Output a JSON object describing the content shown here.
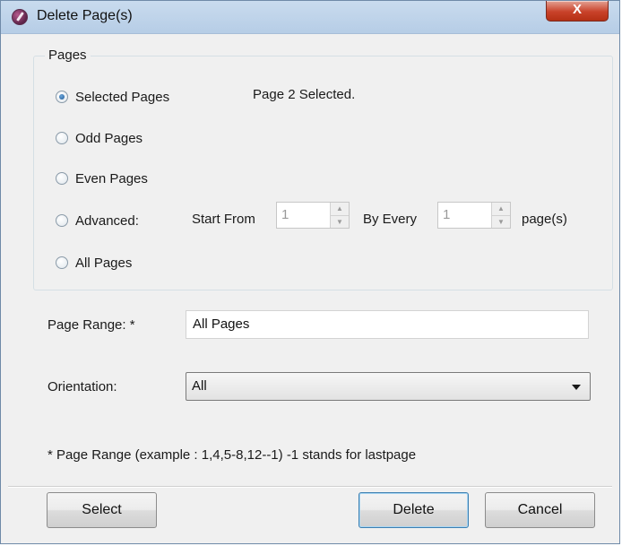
{
  "window": {
    "title": "Delete Page(s)",
    "close_symbol": "X"
  },
  "pages_group": {
    "legend": "Pages",
    "selected_info": "Page 2 Selected.",
    "options": [
      {
        "label": "Selected Pages",
        "checked": true,
        "enabled": true
      },
      {
        "label": "Odd Pages",
        "checked": false,
        "enabled": true
      },
      {
        "label": "Even Pages",
        "checked": false,
        "enabled": true
      },
      {
        "label": "Advanced:",
        "checked": false,
        "enabled": true
      },
      {
        "label": "All Pages",
        "checked": false,
        "enabled": true
      }
    ],
    "advanced": {
      "start_from_label": "Start From",
      "start_from_value": "1",
      "by_every_label": "By Every",
      "by_every_value": "1",
      "unit_label": "page(s)"
    }
  },
  "page_range": {
    "label": "Page Range: *",
    "value": "All Pages"
  },
  "orientation": {
    "label": "Orientation:",
    "value": "All"
  },
  "note": "* Page Range (example : 1,4,5-8,12--1) -1 stands for lastpage",
  "buttons": {
    "select": "Select",
    "delete": "Delete",
    "cancel": "Cancel"
  },
  "icons": {
    "app": "app-icon",
    "close": "close-icon",
    "dropdown": "chevron-down-icon"
  },
  "colors": {
    "title_bar": "#c9dbee",
    "close_button": "#c9422a",
    "selected_radio": "#1f5a97",
    "default_button_border": "#3c7fb1"
  }
}
